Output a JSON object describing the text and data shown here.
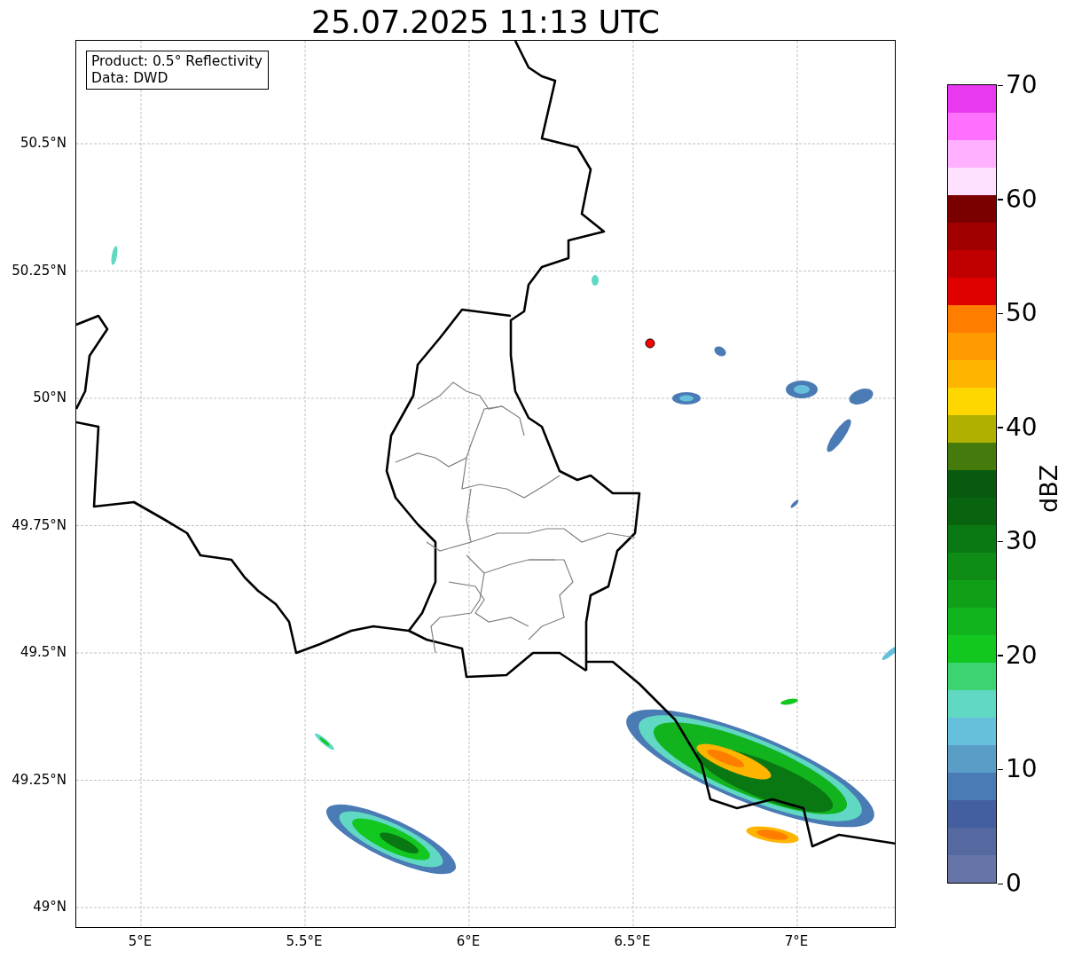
{
  "title": "25.07.2025 11:13 UTC",
  "info_box": [
    "Product: 0.5° Reflectivity",
    "Data: DWD"
  ],
  "y_ticks": [
    "50.5°N",
    "50.25°N",
    "50°N",
    "49.75°N",
    "49.5°N",
    "49.25°N",
    "49°N"
  ],
  "x_ticks": [
    "5°E",
    "5.5°E",
    "6°E",
    "6.5°E",
    "7°E"
  ],
  "colorbar": {
    "label": "dBZ",
    "ticks": [
      "70",
      "60",
      "50",
      "40",
      "30",
      "20",
      "10",
      "0"
    ],
    "segments": [
      {
        "color": "#e838f0"
      },
      {
        "color": "#ff70ff"
      },
      {
        "color": "#ffb0ff"
      },
      {
        "color": "#ffe0ff"
      },
      {
        "color": "#7a0000"
      },
      {
        "color": "#a00000"
      },
      {
        "color": "#c00000"
      },
      {
        "color": "#e00000"
      },
      {
        "color": "#ff7e00"
      },
      {
        "color": "#ff9a00"
      },
      {
        "color": "#ffb400"
      },
      {
        "color": "#ffd700"
      },
      {
        "color": "#b0b000"
      },
      {
        "color": "#457a0c"
      },
      {
        "color": "#085a0e"
      },
      {
        "color": "#08640e"
      },
      {
        "color": "#0a7812"
      },
      {
        "color": "#0e8c16"
      },
      {
        "color": "#10a018"
      },
      {
        "color": "#12b41e"
      },
      {
        "color": "#12c820"
      },
      {
        "color": "#3cd470"
      },
      {
        "color": "#60d8c4"
      },
      {
        "color": "#66c0dc"
      },
      {
        "color": "#5a9ec8"
      },
      {
        "color": "#4a7bb4"
      },
      {
        "color": "#445fa0"
      },
      {
        "color": "#5668a0"
      },
      {
        "color": "#6674a8"
      }
    ]
  }
}
